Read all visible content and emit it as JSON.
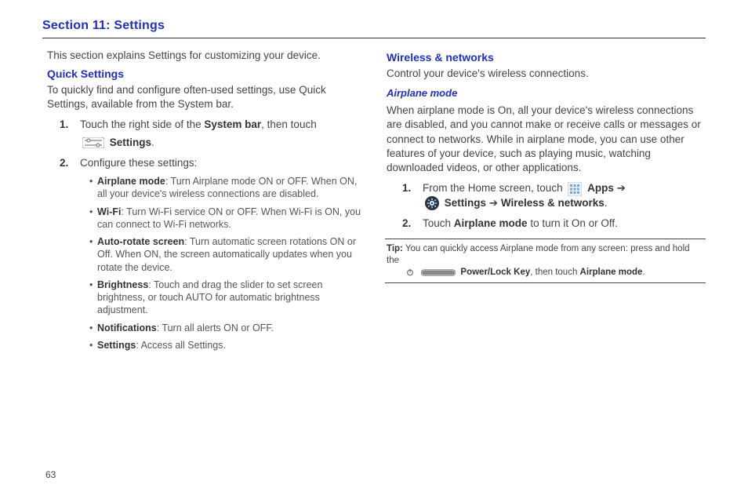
{
  "page_number": "63",
  "section_title": "Section 11: Settings",
  "left": {
    "intro": "This section explains Settings for customizing your device.",
    "quick_settings_h": "Quick Settings",
    "quick_settings_intro": "To quickly find and configure often-used settings, use Quick Settings, available from the System bar.",
    "step1_pre": "Touch the right side of the ",
    "step1_bold": "System bar",
    "step1_post": ", then touch",
    "settings_label": "Settings",
    "step2": "Configure these settings:",
    "bullets": [
      {
        "bold": "Airplane mode",
        "text": ": Turn Airplane mode ON or OFF. When ON, all your device's wireless connections are disabled."
      },
      {
        "bold": "Wi-Fi",
        "text": ": Turn Wi-Fi service ON or OFF. When Wi-Fi is ON, you can connect to Wi-Fi networks."
      },
      {
        "bold": "Auto-rotate screen",
        "text": ": Turn automatic screen rotations ON or Off. When ON, the screen automatically updates when you rotate the device."
      },
      {
        "bold": "Brightness",
        "text": ": Touch and drag the slider to set screen brightness, or touch AUTO for automatic brightness adjustment."
      },
      {
        "bold": "Notifications",
        "text": ": Turn all alerts ON or OFF."
      },
      {
        "bold": "Settings",
        "text": ": Access all Settings."
      }
    ]
  },
  "right": {
    "wireless_h": "Wireless & networks",
    "wireless_intro": "Control your device's wireless connections.",
    "airplane_h": "Airplane mode",
    "airplane_intro": "When airplane mode is On, all your device's wireless connections are disabled, and you cannot make or receive calls or messages or connect to networks.  While in airplane mode, you can use other features of your device, such as playing music, watching downloaded videos, or other applications.",
    "step1_pre": "From the Home screen, touch ",
    "apps_label": "Apps",
    "arrow": " ➔",
    "settings_label": "Settings",
    "arrow2": " ➔ ",
    "wn_label": "Wireless & networks",
    "step2_pre": "Touch ",
    "step2_bold": "Airplane mode",
    "step2_post": " to turn it On or Off.",
    "tip_label": "Tip:",
    "tip_pre": " You can quickly access Airplane mode from any screen: press and hold the ",
    "powerlock": "Power/Lock Key",
    "tip_mid": ", then touch ",
    "airplane_bold": "Airplane mode",
    "tip_end": "."
  }
}
